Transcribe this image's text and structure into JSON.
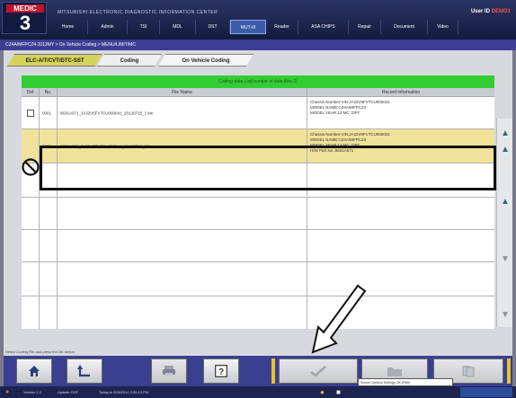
{
  "header": {
    "logo_brand": "MEDIC",
    "logo_version": "3",
    "app_title": "MITSUBISHI ELECTRONIC DIAGNOSTIC INFORMATION CENTER",
    "user_prefix": "User ID",
    "user_id": "DEMO1",
    "menu": [
      "Home",
      "Admin",
      "TSI",
      "MDL",
      "DST",
      "MUT-III",
      "Reader",
      "ASA CHIPS",
      "Repair",
      "Document",
      "Video"
    ],
    "active_menu": "MUT-III"
  },
  "breadcrumb": {
    "text": "CZ4A/MFPCZ4 2013MY  >  On Vehicle Coding  >  MENU/LIMIT/MC"
  },
  "tabs": {
    "dtc": "ELC-A/T/CVT/DTC-SST",
    "coding": "Coding",
    "on_vehicle": "On Vehicle Coding"
  },
  "list": {
    "title": "Coding data List(number of data files:2)",
    "columns": [
      "Del",
      "No.",
      "File Name",
      "Record information"
    ],
    "rows": [
      {
        "no": "0001",
        "file": "8631A071_JA32V5FV7CU000041_20120725_1.bin",
        "record": [
          "Chassis Number:VIN:JA32V5FV7CU000041",
          "MODEL NAME:CZ4A/MFPCZ4",
          "MODEL YEAR:13 MC   :DPT",
          "",
          ""
        ]
      },
      {
        "no": "0002",
        "file": "8631A071_JA32V5FV7CU000041_20120724_1.bin",
        "record": [
          "Chassis Number:VIN:JA32V5FV7CU000041",
          "MODEL NAME:CZ4A/MFPCZ4",
          "MODEL YEAR:13 MC   :DPT",
          "H/W Part No.:8631A071"
        ]
      }
    ]
  },
  "hint": "Select Coding File and press the OK button",
  "taskbar": {
    "version": "Version 1.2",
    "update": "Update: DSF",
    "time": "Today is 9/28/2012 2:58:13 PM",
    "tooltip": "Screen Options  Settings  OK (P8B)"
  },
  "colors": {
    "list_title_bg": "#33cc33",
    "highlight_row": "#f0e29a",
    "nav_bg": "#3a3f8f",
    "active_tab": "#d6d35a"
  }
}
